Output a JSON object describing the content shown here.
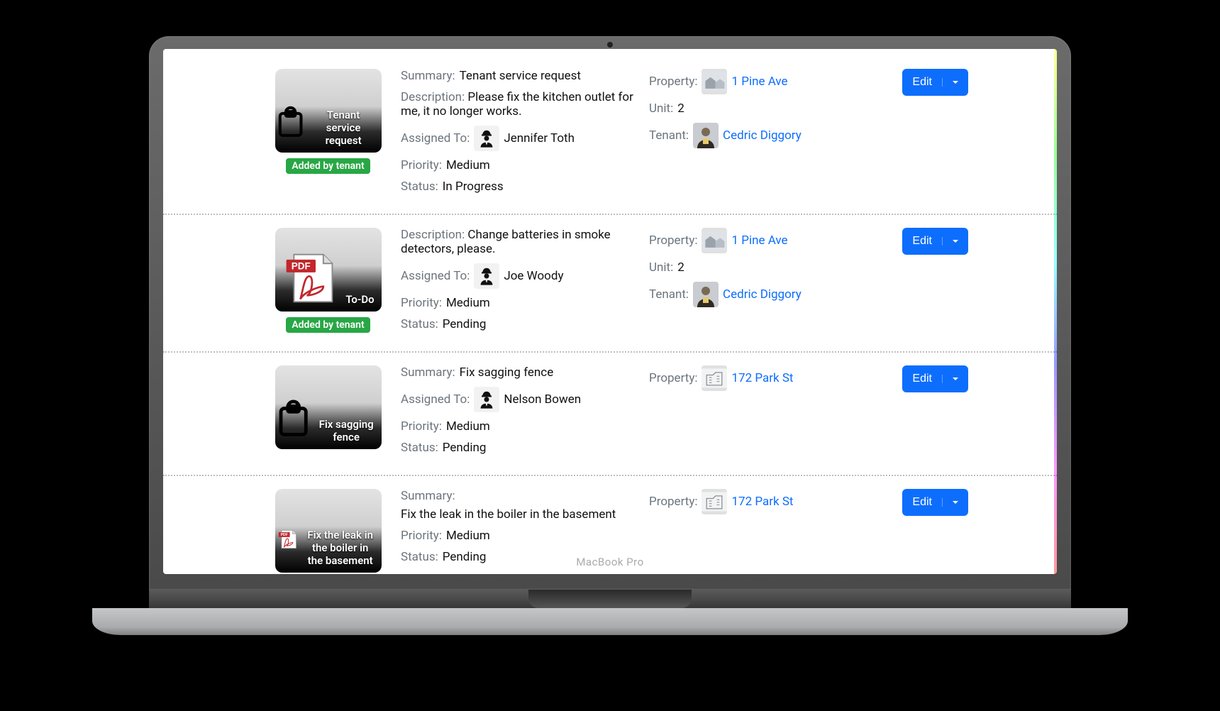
{
  "device_label": "MacBook Pro",
  "labels": {
    "summary": "Summary:",
    "description": "Description:",
    "assigned_to": "Assigned To:",
    "priority": "Priority:",
    "status": "Status:",
    "property": "Property:",
    "unit": "Unit:",
    "tenant": "Tenant:",
    "edit": "Edit"
  },
  "badges": {
    "added_by_tenant": "Added by tenant"
  },
  "tasks": [
    {
      "thumb_type": "clipboard",
      "thumb_caption": "Tenant service request",
      "added_by_tenant": true,
      "summary": "Tenant service request",
      "description": "Please fix the kitchen outlet for me, it no longer works.",
      "assigned_to": "Jennifer Toth",
      "priority": "Medium",
      "status": "In Progress",
      "property": "1 Pine Ave",
      "unit": "2",
      "tenant": "Cedric Diggory"
    },
    {
      "thumb_type": "pdf",
      "thumb_caption": "To-Do",
      "added_by_tenant": true,
      "summary": "",
      "description": "Change batteries in smoke detectors, please.",
      "assigned_to": "Joe Woody",
      "priority": "Medium",
      "status": "Pending",
      "property": "1 Pine Ave",
      "unit": "2",
      "tenant": "Cedric Diggory"
    },
    {
      "thumb_type": "clipboard",
      "thumb_caption": "Fix sagging fence",
      "added_by_tenant": false,
      "summary": "Fix sagging fence",
      "description": "",
      "assigned_to": "Nelson Bowen",
      "priority": "Medium",
      "status": "Pending",
      "property": "172 Park St",
      "unit": "",
      "tenant": ""
    },
    {
      "thumb_type": "pdf",
      "thumb_caption": "Fix the leak in the boiler in the basement",
      "added_by_tenant": false,
      "summary": "Fix the leak in the boiler in the basement",
      "description": "",
      "assigned_to": "",
      "priority": "Medium",
      "status": "Pending",
      "property": "172 Park St",
      "unit": "",
      "tenant": ""
    }
  ]
}
